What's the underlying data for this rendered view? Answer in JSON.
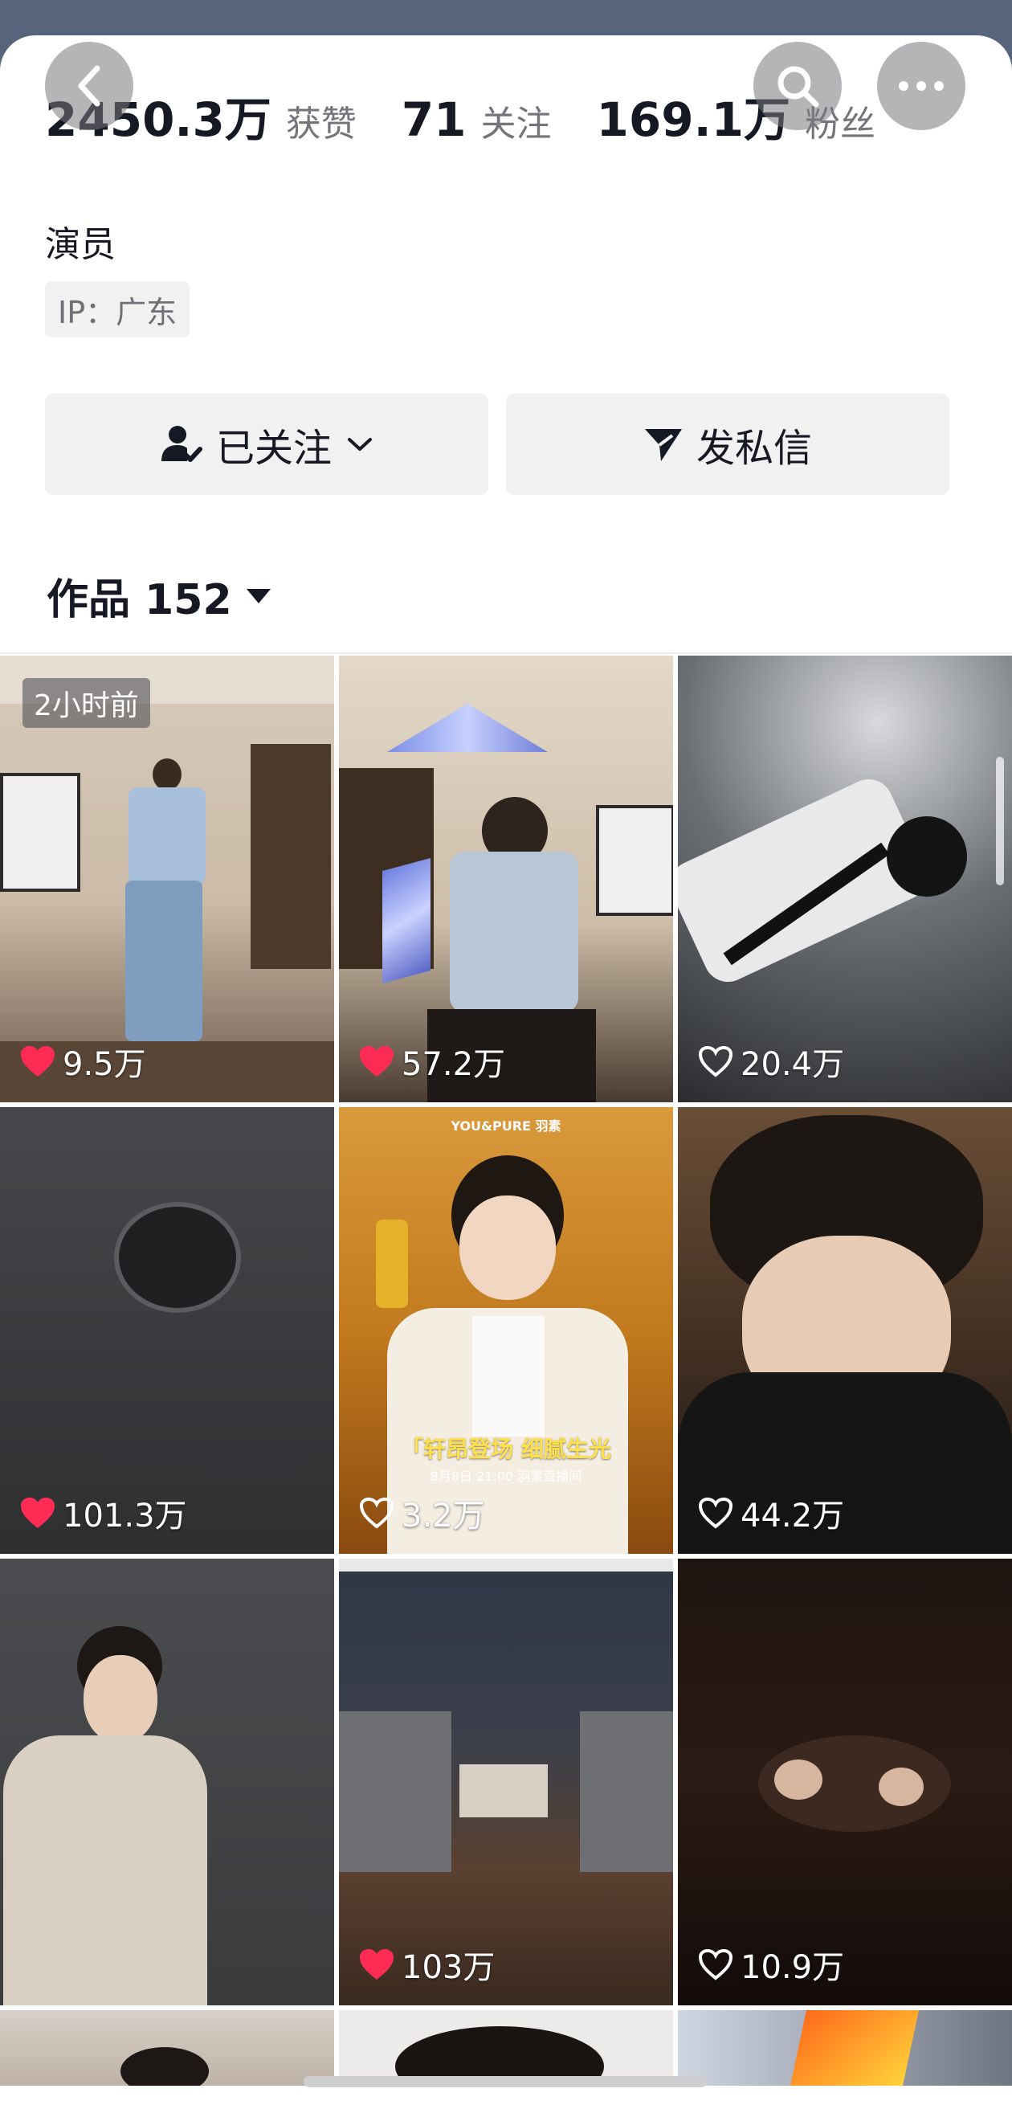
{
  "stats": [
    {
      "value": "2450.3万",
      "label": "获赞"
    },
    {
      "value": "71",
      "label": "关注"
    },
    {
      "value": "169.1万",
      "label": "粉丝"
    }
  ],
  "profile": {
    "role": "演员",
    "ip": "IP：广东"
  },
  "actions": {
    "follow_label": "已关注",
    "message_label": "发私信"
  },
  "works": {
    "title": "作品 152"
  },
  "videos": [
    {
      "likes": "9.5万",
      "liked": true,
      "badge": "2小时前"
    },
    {
      "likes": "57.2万",
      "liked": true,
      "badge": ""
    },
    {
      "likes": "20.4万",
      "liked": false,
      "badge": ""
    },
    {
      "likes": "101.3万",
      "liked": true,
      "badge": ""
    },
    {
      "likes": "3.2万",
      "liked": false,
      "badge": ""
    },
    {
      "likes": "44.2万",
      "liked": false,
      "badge": ""
    },
    {
      "likes": "",
      "liked": false,
      "badge": ""
    },
    {
      "likes": "103万",
      "liked": true,
      "badge": ""
    },
    {
      "likes": "10.9万",
      "liked": false,
      "badge": ""
    }
  ],
  "ad_card": {
    "brand": "YOU&PURE 羽素",
    "headline": "「轩昂登场 细腻生光",
    "subline": "8月8日 21:00 羽素直播间"
  },
  "colors": {
    "like_red": "#fe2c55",
    "backdrop": "#56647c"
  },
  "icons": [
    "back-icon",
    "search-icon",
    "more-icon",
    "follow-user-icon",
    "chevron-down-icon",
    "send-icon",
    "triangle-down-icon",
    "heart-icon"
  ]
}
